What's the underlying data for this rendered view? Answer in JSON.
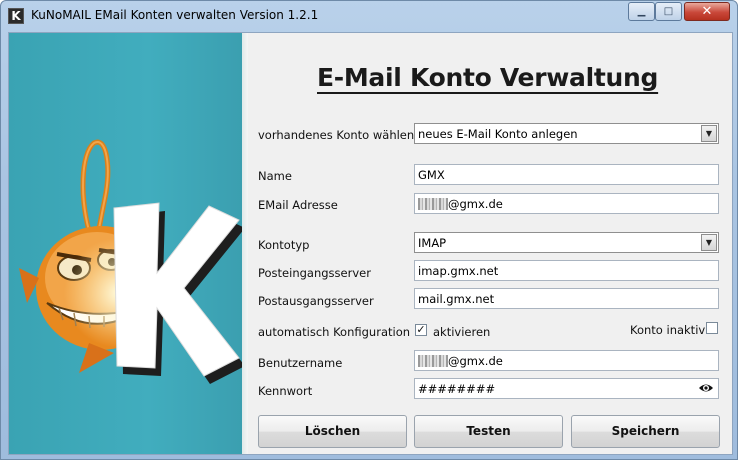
{
  "window": {
    "title": "KuNoMAIL EMail Konten verwalten Version 1.2.1",
    "app_icon_letter": "K",
    "min_glyph": "▁",
    "max_glyph": "□",
    "close_glyph": "✕"
  },
  "heading": "E-Mail Konto Verwaltung",
  "form": {
    "existing_account_label": "vorhandenes Konto wählen",
    "existing_account_value": "neues E-Mail Konto anlegen",
    "name_label": "Name",
    "name_value": "GMX",
    "email_label": "EMail Adresse",
    "email_value": "@gmx.de",
    "account_type_label": "Kontotyp",
    "account_type_value": "IMAP",
    "incoming_label": "Posteingangsserver",
    "incoming_value": "imap.gmx.net",
    "outgoing_label": "Postausgangsserver",
    "outgoing_value": "mail.gmx.net",
    "auto_config_label": "automatisch Konfiguration",
    "auto_config_checkbox_label": "aktivieren",
    "auto_config_checked": true,
    "inactive_label": "Konto inaktiv",
    "inactive_checked": false,
    "username_label": "Benutzername",
    "username_value": "@gmx.de",
    "password_label": "Kennwort",
    "password_value": "########"
  },
  "buttons": {
    "delete_label": "Löschen",
    "test_label": "Testen",
    "save_label": "Speichern"
  },
  "colors": {
    "teal_panel": "#3aa3b3",
    "window_frame": "#b9d1ea",
    "close_button": "#c9483a"
  },
  "icons": {
    "dropdown": "chevron-down-icon",
    "password_reveal": "eye-icon",
    "logo": "kunomail-mascot-logo"
  }
}
